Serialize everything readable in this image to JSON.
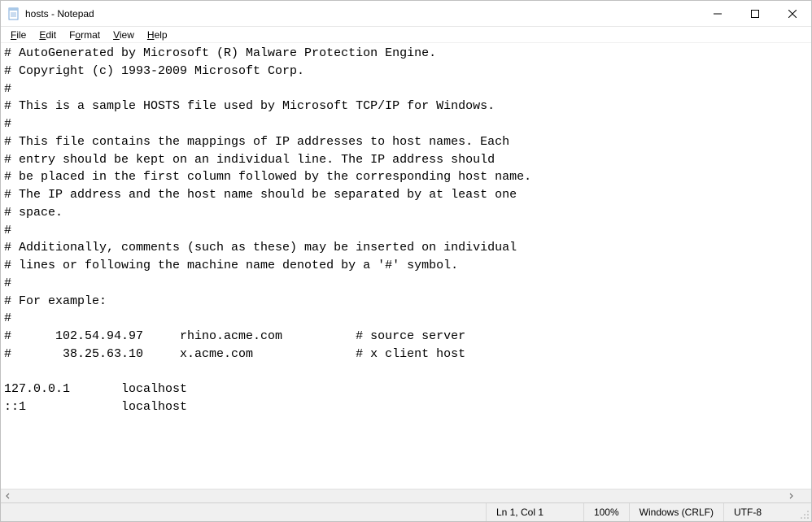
{
  "window": {
    "title": "hosts - Notepad"
  },
  "menubar": {
    "file": "File",
    "edit": "Edit",
    "format": "Format",
    "view": "View",
    "help": "Help"
  },
  "editor": {
    "content": "# AutoGenerated by Microsoft (R) Malware Protection Engine.\n# Copyright (c) 1993-2009 Microsoft Corp.\n#\n# This is a sample HOSTS file used by Microsoft TCP/IP for Windows.\n#\n# This file contains the mappings of IP addresses to host names. Each\n# entry should be kept on an individual line. The IP address should\n# be placed in the first column followed by the corresponding host name.\n# The IP address and the host name should be separated by at least one\n# space.\n#\n# Additionally, comments (such as these) may be inserted on individual\n# lines or following the machine name denoted by a '#' symbol.\n#\n# For example:\n#\n#      102.54.94.97     rhino.acme.com          # source server\n#       38.25.63.10     x.acme.com              # x client host\n\n127.0.0.1       localhost\n::1             localhost"
  },
  "statusbar": {
    "position": "Ln 1, Col 1",
    "zoom": "100%",
    "line_ending": "Windows (CRLF)",
    "encoding": "UTF-8"
  }
}
